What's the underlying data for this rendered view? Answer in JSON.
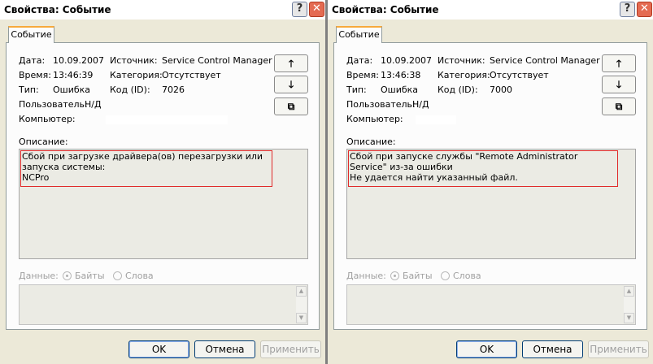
{
  "windows": [
    {
      "title": "Свойства: Событие",
      "tab": "Событие",
      "fields": {
        "date_label": "Дата:",
        "date_value": "10.09.2007",
        "time_label": "Время:",
        "time_value": "13:46:39",
        "type_label": "Тип:",
        "type_value": "Ошибка",
        "user_label": "Пользователь:",
        "user_value": "Н/Д",
        "computer_label": "Компьютер:",
        "source_label": "Источник:",
        "source_value": "Service Control Manager",
        "category_label": "Категория:",
        "category_value": "Отсутствует",
        "id_label": "Код (ID):",
        "id_value": "7026"
      },
      "description_label": "Описание:",
      "description": "Сбой при загрузке драйвера(ов) перезагрузки или запуска системы:\nNCPro",
      "data_label": "Данные:",
      "radio_bytes": "Байты",
      "radio_words": "Слова",
      "buttons": {
        "ok": "OK",
        "cancel": "Отмена",
        "apply": "Применить"
      }
    },
    {
      "title": "Свойства: Событие",
      "tab": "Событие",
      "fields": {
        "date_label": "Дата:",
        "date_value": "10.09.2007",
        "time_label": "Время:",
        "time_value": "13:46:38",
        "type_label": "Тип:",
        "type_value": "Ошибка",
        "user_label": "Пользователь:",
        "user_value": "Н/Д",
        "computer_label": "Компьютер:",
        "source_label": "Источник:",
        "source_value": "Service Control Manager",
        "category_label": "Категория:",
        "category_value": "Отсутствует",
        "id_label": "Код (ID):",
        "id_value": "7000"
      },
      "description_label": "Описание:",
      "description": "Сбой при запуске службы \"Remote Administrator Service\" из-за ошибки\nНе удается найти указанный файл.",
      "data_label": "Данные:",
      "radio_bytes": "Байты",
      "radio_words": "Слова",
      "buttons": {
        "ok": "OK",
        "cancel": "Отмена",
        "apply": "Применить"
      }
    }
  ],
  "icons": {
    "help": "question-mark-icon",
    "close": "close-x-icon",
    "prev": "arrow-up-icon",
    "next": "arrow-down-icon",
    "copy": "copy-clipboard-icon"
  },
  "colors": {
    "highlight_border": "#e02a2a",
    "tab_accent": "#f7a93b",
    "close_button": "#e46b52"
  }
}
